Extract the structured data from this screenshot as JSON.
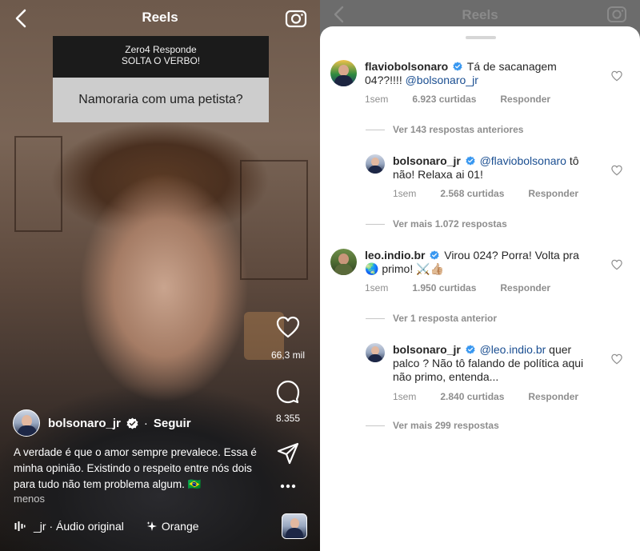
{
  "reel": {
    "nav_title": "Reels",
    "question": {
      "header_line1": "Zero4 Responde",
      "header_line2": "SOLTA O VERBO!",
      "text": "Namoraria com uma petista?"
    },
    "likes": "66,3 mil",
    "comments": "8.355",
    "author": {
      "username": "bolsonaro_jr",
      "separator": "·",
      "follow_label": "Seguir"
    },
    "caption": "A verdade é que o amor sempre prevalece. Essa é minha opinião. Existindo o respeito entre nós dois para tudo não tem problema algum. 🇧🇷",
    "less_label": "menos",
    "audio_label": "_jr · Áudio original",
    "effect_label": "Orange"
  },
  "comments_sheet": {
    "nav_title": "Reels",
    "threads": [
      {
        "username": "flaviobolsonaro",
        "text_line1": "Tá de sacanagem",
        "text_line2": "04??!!!!",
        "mention": "@bolsonaro_jr",
        "time": "1sem",
        "likes": "6.923 curtidas",
        "reply_label": "Responder",
        "more": "Ver 143 respostas anteriores"
      },
      {
        "username": "bolsonaro_jr",
        "mention": "@flaviobolsonaro",
        "text_tail": "tô",
        "text_line2": "não! Relaxa ai 01!",
        "time": "1sem",
        "likes": "2.568 curtidas",
        "reply_label": "Responder",
        "more": "Ver mais 1.072 respostas"
      },
      {
        "username": "leo.indio.br",
        "text_line1": "Virou 024? Porra! Volta pra",
        "text_line2": "🌏 primo! ⚔️👍🏼",
        "time": "1sem",
        "likes": "1.950 curtidas",
        "reply_label": "Responder",
        "more": "Ver 1 resposta anterior"
      },
      {
        "username": "bolsonaro_jr",
        "mention": "@leo.indio.br",
        "text_tail": "quer",
        "text_line2": "palco ? Não tô falando de política aqui",
        "text_line3": "não primo, entenda...",
        "time": "1sem",
        "likes": "2.840 curtidas",
        "reply_label": "Responder",
        "more": "Ver mais 299 respostas"
      }
    ]
  },
  "colors": {
    "verified": "#3897f0",
    "mention": "#1a4e91",
    "meta_gray": "#8e8e8e",
    "question_header_bg": "#1b1b1b",
    "question_body_bg": "#cdcdcd"
  },
  "icons": {
    "back": "chevron-left-icon",
    "camera": "camera-icon",
    "like": "heart-icon",
    "comment": "comment-bubble-icon",
    "share": "paper-plane-icon",
    "more": "more-horizontal-icon",
    "verified": "verified-badge-icon",
    "audio": "audio-bars-icon",
    "effect": "sparkle-icon"
  }
}
